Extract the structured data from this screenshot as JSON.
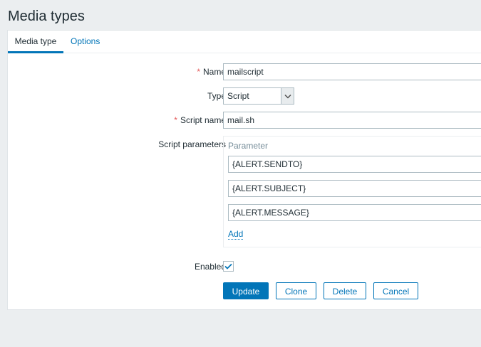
{
  "page": {
    "title": "Media types"
  },
  "tabs": [
    {
      "label": "Media type",
      "active": true
    },
    {
      "label": "Options",
      "active": false
    }
  ],
  "form": {
    "required_mark": "*",
    "name": {
      "label": "Name",
      "value": "mailscript"
    },
    "type": {
      "label": "Type",
      "value": "Script"
    },
    "script_name": {
      "label": "Script name",
      "value": "mail.sh"
    },
    "script_parameters": {
      "label": "Script parameters",
      "header": "Parameter",
      "params": [
        "{ALERT.SENDTO}",
        "{ALERT.SUBJECT}",
        "{ALERT.MESSAGE}"
      ],
      "add_label": "Add"
    },
    "enabled": {
      "label": "Enabled",
      "checked": true
    }
  },
  "buttons": {
    "update": "Update",
    "clone": "Clone",
    "delete": "Delete",
    "cancel": "Cancel"
  },
  "colors": {
    "accent": "#0275b8",
    "required": "#e45959",
    "background": "#ebeef0"
  },
  "icons": {
    "select_arrow": "chevron-down-icon",
    "checkbox": "checkmark-icon"
  }
}
